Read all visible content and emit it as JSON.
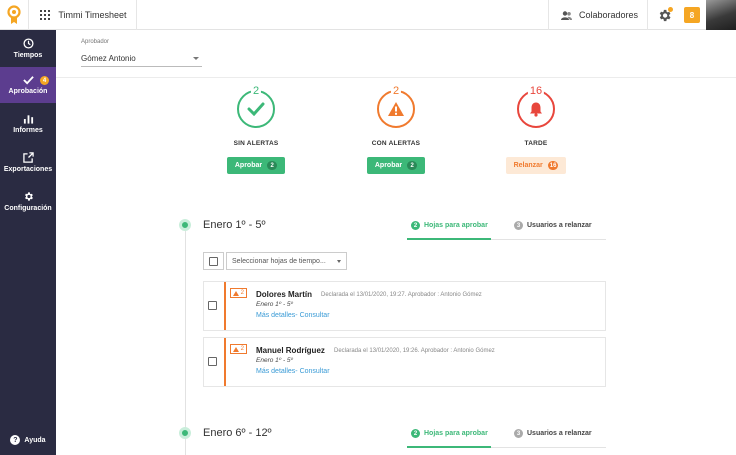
{
  "topbar": {
    "app_name": "Timmi Timesheet",
    "collaborators_label": "Colaboradores",
    "notifications_count": "8"
  },
  "sidebar": {
    "items": [
      {
        "label": "Tiempos",
        "icon": "clock-icon"
      },
      {
        "label": "Aprobación",
        "icon": "check-icon",
        "badge": "4"
      },
      {
        "label": "Informes",
        "icon": "bar-chart-icon"
      },
      {
        "label": "Exportaciones",
        "icon": "export-icon"
      },
      {
        "label": "Configuración",
        "icon": "gear-icon"
      }
    ],
    "help_label": "Ayuda",
    "active_color": "#5c3d8f",
    "bg_color": "#2a2b42"
  },
  "approver": {
    "label": "Aprobador",
    "value": "Gómez Antonio"
  },
  "status_cards": [
    {
      "count": "2",
      "title": "SIN ALERTAS",
      "button": "Aprobar",
      "button_count": "2",
      "color": "#3cb878"
    },
    {
      "count": "2",
      "title": "CON ALERTAS",
      "button": "Aprobar",
      "button_count": "2",
      "color": "#f07a2e"
    },
    {
      "count": "16",
      "title": "TARDE",
      "button": "Relanzar",
      "button_count": "16",
      "color": "#e8463c"
    }
  ],
  "periods": [
    {
      "title": "Enero 1º - 5º",
      "tab_approve": {
        "count": "2",
        "label": "Hojas para aprobar"
      },
      "tab_relaunch": {
        "count": "3",
        "label": "Usuarios a relanzar"
      },
      "select_placeholder": "Seleccionar hojas de tiempo...",
      "sheets": [
        {
          "warning": "2",
          "name": "Dolores Martín",
          "declared": "Declarada el 13/01/2020, 19:27. Aprobador : Antonio Gómez",
          "period": "Enero 1º - 5º",
          "more": "Más detalles- Consultar"
        },
        {
          "warning": "2",
          "name": "Manuel Rodríguez",
          "declared": "Declarada el 13/01/2020, 19:26. Aprobador : Antonio Gómez",
          "period": "Enero 1º - 5º",
          "more": "Más detalles- Consultar"
        }
      ]
    },
    {
      "title": "Enero 6º - 12º",
      "tab_approve": {
        "count": "2",
        "label": "Hojas para aprobar"
      },
      "tab_relaunch": {
        "count": "3",
        "label": "Usuarios a relanzar"
      }
    }
  ]
}
